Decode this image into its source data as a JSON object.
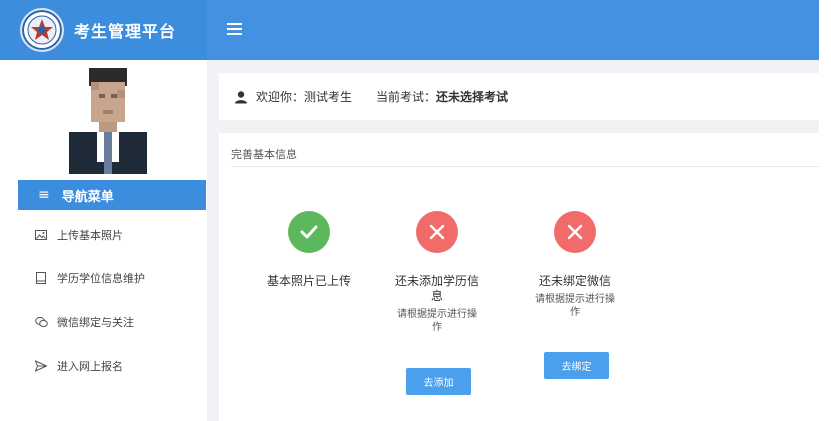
{
  "header": {
    "app_title": "考生管理平台"
  },
  "sidebar": {
    "nav_title": "导航菜单",
    "items": [
      {
        "label": "上传基本照片",
        "icon": "image-icon"
      },
      {
        "label": "学历学位信息维护",
        "icon": "book-icon"
      },
      {
        "label": "微信绑定与关注",
        "icon": "wechat-icon"
      },
      {
        "label": "进入网上报名",
        "icon": "send-icon"
      }
    ]
  },
  "welcome": {
    "greeting": "欢迎你：测试考生",
    "exam_label": "当前考试：",
    "exam_value": "还未选择考试"
  },
  "card": {
    "title": "完善基本信息",
    "steps": [
      {
        "status": "done",
        "label": "基本照片已上传"
      },
      {
        "status": "todo",
        "label_line1": "还未添加学历信",
        "label_line2": "息",
        "hint_line1": "请根据提示进行操",
        "hint_line2": "作",
        "button": "去添加"
      },
      {
        "status": "todo",
        "label_line1": "还未绑定微信",
        "hint_line1": "请根据提示进行操",
        "hint_line2": "作",
        "button": "去绑定"
      }
    ]
  },
  "colors": {
    "primary": "#3c8dde",
    "success": "#5cb85c",
    "danger": "#f26b6b",
    "button": "#4aa0ec"
  }
}
